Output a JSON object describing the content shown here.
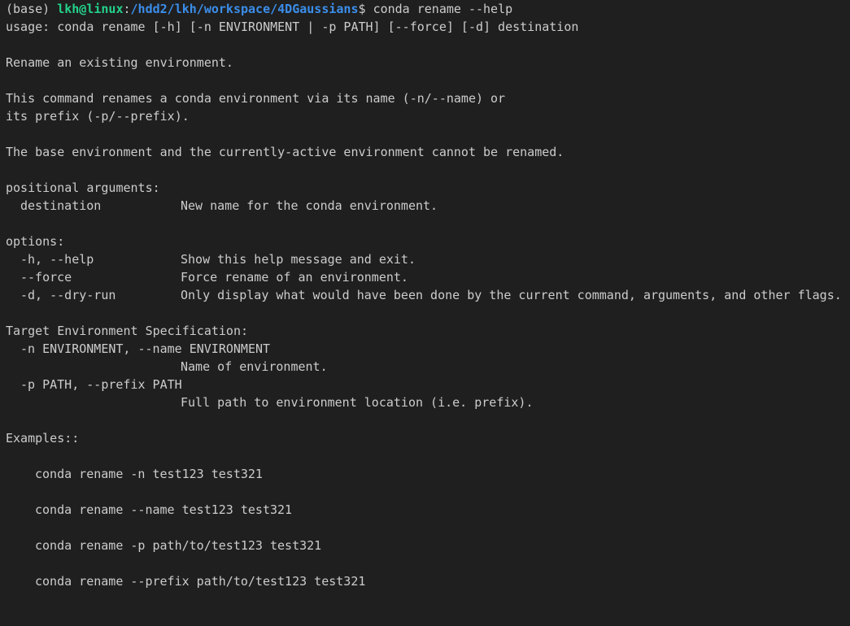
{
  "colors": {
    "background": "#1f1f1f",
    "text": "#cccccc",
    "user_host": "#23d18b",
    "cwd_path": "#3b8eea"
  },
  "prompt": {
    "env": "(base) ",
    "user_host": "lkh@linux",
    "separator": ":",
    "cwd": "/hdd2/lkh/workspace/4DGaussians",
    "symbol": "$ ",
    "command": "conda rename --help"
  },
  "usage": "usage: conda rename [-h] [-n ENVIRONMENT | -p PATH] [--force] [-d] destination",
  "summary": "Rename an existing environment.",
  "description": [
    "This command renames a conda environment via its name (-n/--name) or",
    "its prefix (-p/--prefix)."
  ],
  "note": "The base environment and the currently-active environment cannot be renamed.",
  "positional": {
    "heading": "positional arguments:",
    "items": [
      {
        "flag": "destination",
        "desc": "New name for the conda environment."
      }
    ]
  },
  "options": {
    "heading": "options:",
    "items": [
      {
        "flag": "-h, --help",
        "desc": "Show this help message and exit."
      },
      {
        "flag": "--force",
        "desc": "Force rename of an environment."
      },
      {
        "flag": "-d, --dry-run",
        "desc": "Only display what would have been done by the current command, arguments, and other flags."
      }
    ]
  },
  "target": {
    "heading": "Target Environment Specification:",
    "items": [
      {
        "flag": "-n ENVIRONMENT, --name ENVIRONMENT",
        "desc": "Name of environment."
      },
      {
        "flag": "-p PATH, --prefix PATH",
        "desc": "Full path to environment location (i.e. prefix)."
      }
    ]
  },
  "examples": {
    "heading": "Examples::",
    "items": [
      "conda rename -n test123 test321",
      "conda rename --name test123 test321",
      "conda rename -p path/to/test123 test321",
      "conda rename --prefix path/to/test123 test321"
    ]
  }
}
